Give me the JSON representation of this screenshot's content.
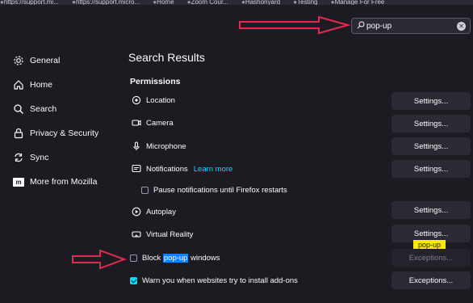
{
  "bookmarks": [
    "https://support.mi...",
    "https://support.micro...",
    "Home",
    "Zoom Cour...",
    "Hashonyard",
    "Testing",
    "Manage For Free"
  ],
  "search": {
    "value": "pop-up",
    "clear_icon": "close-circle-icon"
  },
  "sidebar": {
    "items": [
      {
        "label": "General",
        "icon": "gear-icon"
      },
      {
        "label": "Home",
        "icon": "home-icon"
      },
      {
        "label": "Search",
        "icon": "search-icon"
      },
      {
        "label": "Privacy & Security",
        "icon": "lock-icon"
      },
      {
        "label": "Sync",
        "icon": "sync-icon"
      },
      {
        "label": "More from Mozilla",
        "icon": "mozilla-logo-icon"
      }
    ]
  },
  "main": {
    "title": "Search Results",
    "group": "Permissions",
    "permissions": [
      {
        "label": "Location",
        "button": "Settings...",
        "icon": "location-icon"
      },
      {
        "label": "Camera",
        "button": "Settings...",
        "icon": "camera-icon"
      },
      {
        "label": "Microphone",
        "button": "Settings...",
        "icon": "microphone-icon"
      },
      {
        "label": "Notifications",
        "button": "Settings...",
        "icon": "notification-icon",
        "link": "Learn more"
      },
      {
        "label": "Autoplay",
        "button": "Settings...",
        "icon": "autoplay-icon"
      },
      {
        "label": "Virtual Reality",
        "button": "Settings...",
        "icon": "vr-headset-icon"
      }
    ],
    "pause_notifications": "Pause notifications until Firefox restarts",
    "block_popups": {
      "before": "Block ",
      "highlight": "pop-up",
      "after": " windows",
      "checked": false,
      "button": "Exceptions..."
    },
    "warn_addons": {
      "label": "Warn you when websites try to install add-ons",
      "checked": true,
      "button": "Exceptions..."
    },
    "tooltip": "pop-up"
  },
  "colors": {
    "background": "#1c1b22",
    "accent": "#00ddff",
    "highlight": "#0a84ff",
    "tooltip": "#ffe900",
    "annotation": "#e22850"
  }
}
